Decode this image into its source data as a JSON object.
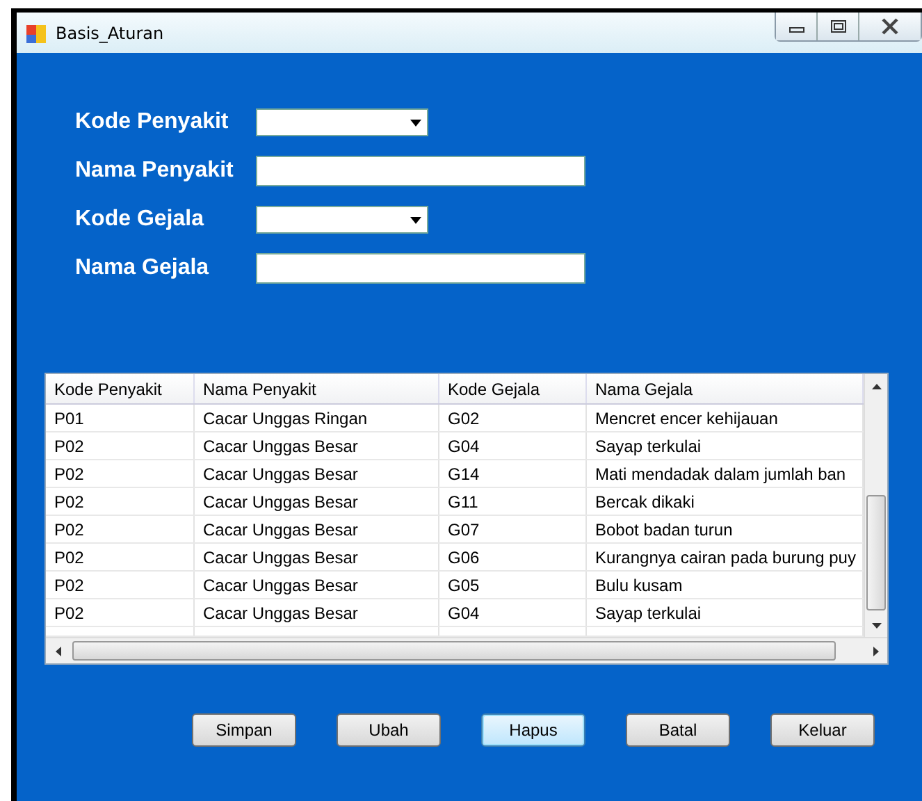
{
  "window": {
    "title": "Basis_Aturan"
  },
  "form": {
    "fields": [
      {
        "label": "Kode Penyakit",
        "kind": "dropdown"
      },
      {
        "label": "Nama Penyakit",
        "kind": "text"
      },
      {
        "label": "Kode Gejala",
        "kind": "dropdown"
      },
      {
        "label": "Nama Gejala",
        "kind": "text"
      }
    ]
  },
  "table": {
    "columns": [
      "Kode Penyakit",
      "Nama Penyakit",
      "Kode Gejala",
      "Nama Gejala"
    ],
    "rows": [
      [
        "P01",
        "Cacar Unggas Ringan",
        "G02",
        "Mencret encer kehijauan"
      ],
      [
        "P02",
        "Cacar Unggas Besar",
        "G04",
        "Sayap terkulai"
      ],
      [
        "P02",
        "Cacar Unggas Besar",
        "G14",
        "Mati mendadak dalam jumlah ban"
      ],
      [
        "P02",
        "Cacar Unggas Besar",
        "G11",
        "Bercak dikaki"
      ],
      [
        "P02",
        "Cacar Unggas Besar",
        "G07",
        "Bobot badan turun"
      ],
      [
        "P02",
        "Cacar Unggas Besar",
        "G06",
        "Kurangnya cairan pada burung puy"
      ],
      [
        "P02",
        "Cacar Unggas Besar",
        "G05",
        "Bulu kusam"
      ],
      [
        "P02",
        "Cacar Unggas Besar",
        "G04",
        "Sayap terkulai"
      ]
    ]
  },
  "buttons": [
    {
      "label": "Simpan",
      "focused": false
    },
    {
      "label": "Ubah",
      "focused": false
    },
    {
      "label": "Hapus",
      "focused": true
    },
    {
      "label": "Batal",
      "focused": false
    },
    {
      "label": "Keluar",
      "focused": false
    }
  ]
}
